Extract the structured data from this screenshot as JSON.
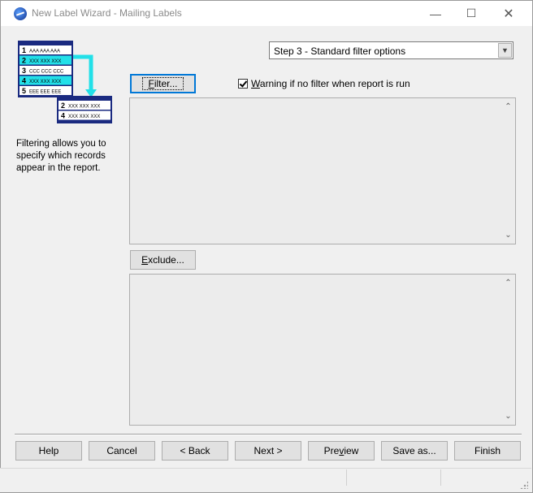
{
  "window": {
    "title": "New Label Wizard - Mailing Labels",
    "minimize_glyph": "—",
    "maximize_glyph": "☐",
    "close_glyph": "✕"
  },
  "illustration": {
    "rows": [
      {
        "num": "1",
        "text": "AAA AAA AAA"
      },
      {
        "num": "2",
        "text": "XXX XXX XXX"
      },
      {
        "num": "3",
        "text": "CCC CCC CCC"
      },
      {
        "num": "4",
        "text": "XXX XXX XXX"
      },
      {
        "num": "5",
        "text": "EEE EEE EEE"
      }
    ],
    "result_rows": [
      {
        "num": "2",
        "text": "XXX XXX XXX"
      },
      {
        "num": "4",
        "text": "XXX XXX XXX"
      }
    ]
  },
  "side_description": "Filtering allows you to specify which records appear in the report.",
  "step_select": {
    "value": "Step 3 - Standard filter options"
  },
  "filter_button": {
    "mnemonic": "F",
    "rest": "ilter..."
  },
  "warning_checkbox": {
    "checked": true,
    "mnemonic": "W",
    "rest": "arning if no filter when report is run"
  },
  "exclude_button": {
    "mnemonic": "E",
    "rest": "xclude..."
  },
  "scroll_up": "⌃",
  "scroll_down": "⌄",
  "bottom_buttons": {
    "help": "Help",
    "cancel": "Cancel",
    "back": "< Back",
    "next": "Next >",
    "preview_pre": "Pre",
    "preview_mn": "v",
    "preview_post": "iew",
    "saveas": "Save as...",
    "finish": "Finish"
  },
  "colors": {
    "accent": "#0078d7",
    "illus_navy": "#1a2a80",
    "illus_cyan": "#22e0e8"
  }
}
